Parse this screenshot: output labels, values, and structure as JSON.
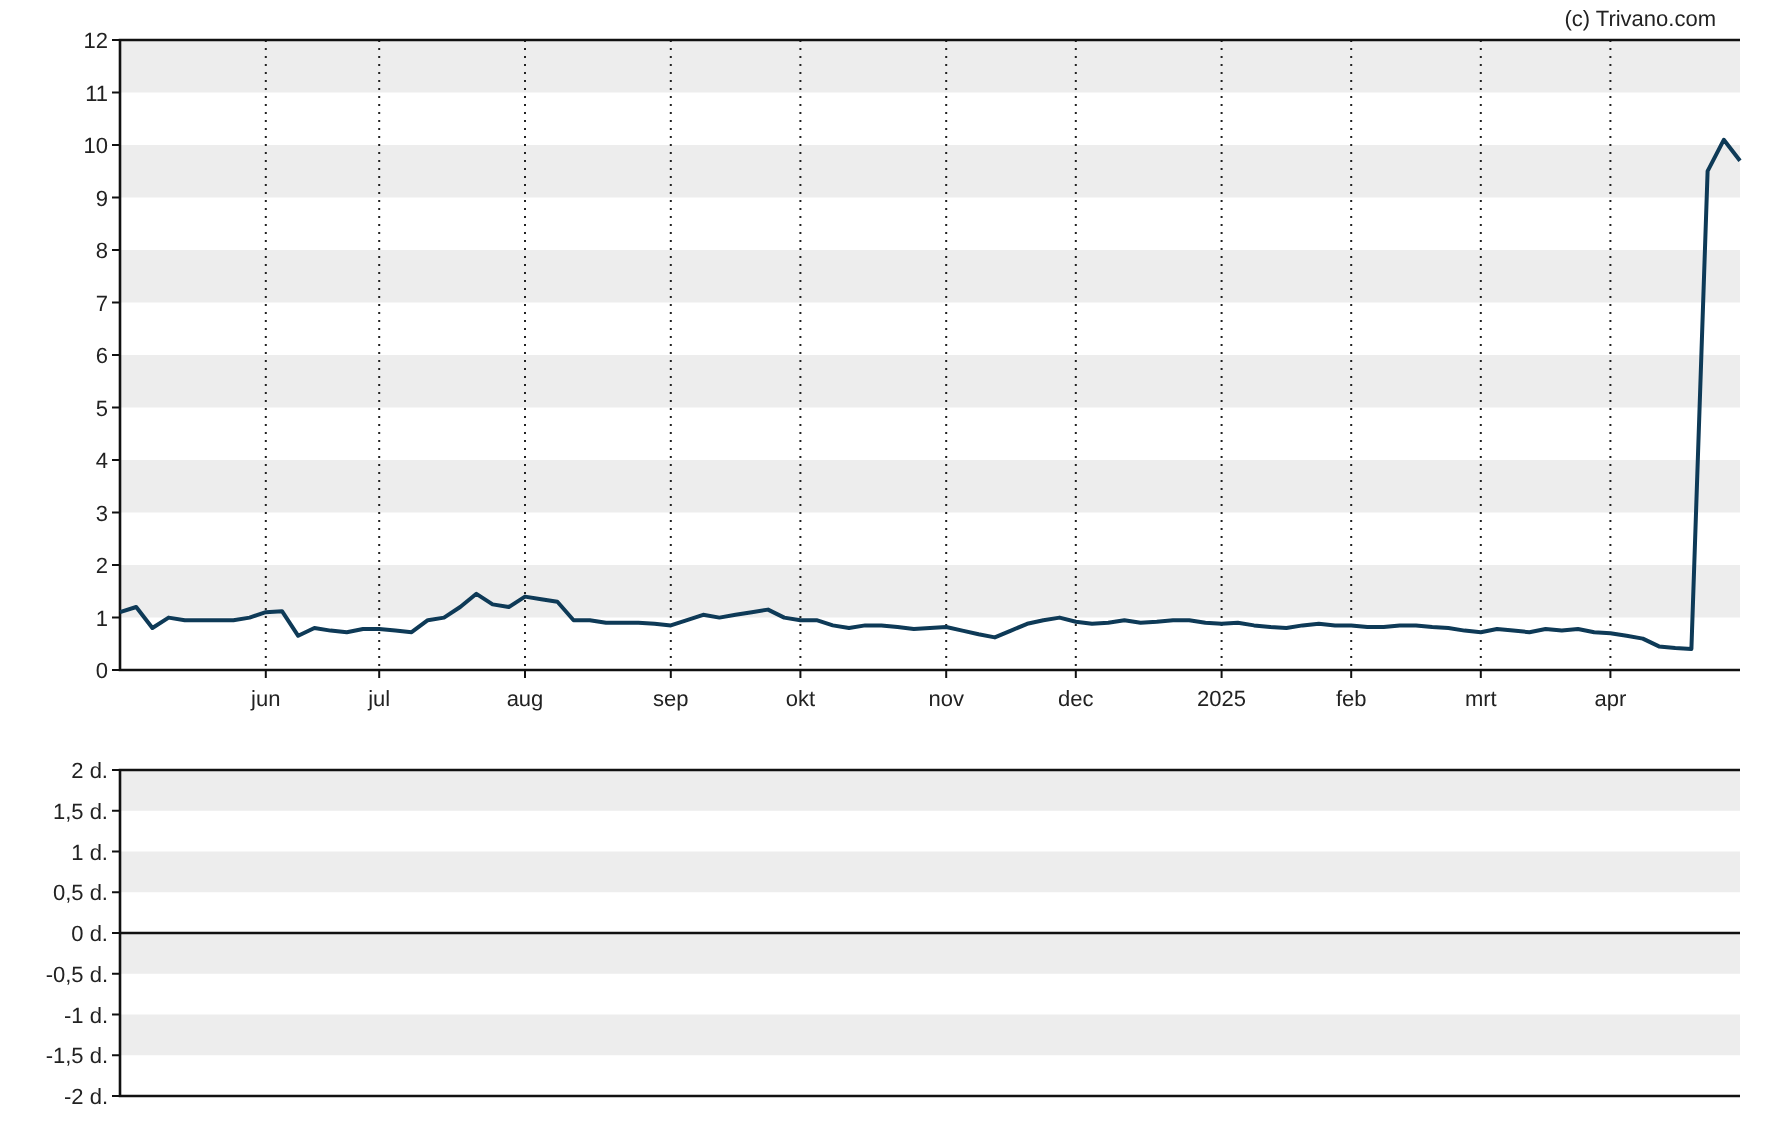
{
  "copyright": "(c) Trivano.com",
  "price_chart": {
    "chart_data": {
      "type": "line",
      "grid": true,
      "ylim": [
        0,
        12
      ],
      "yticks": [
        0,
        1,
        2,
        3,
        4,
        5,
        6,
        7,
        8,
        9,
        10,
        11,
        12
      ],
      "categories": [
        null,
        null,
        null,
        null,
        null,
        null,
        null,
        null,
        null,
        "jun",
        null,
        null,
        null,
        null,
        null,
        null,
        "jul",
        null,
        null,
        null,
        null,
        null,
        null,
        null,
        null,
        "aug",
        null,
        null,
        null,
        null,
        null,
        null,
        null,
        null,
        "sep",
        null,
        null,
        null,
        null,
        null,
        null,
        null,
        "okt",
        null,
        null,
        null,
        null,
        null,
        null,
        null,
        null,
        "nov",
        null,
        null,
        null,
        null,
        null,
        null,
        null,
        "dec",
        null,
        null,
        null,
        null,
        null,
        null,
        null,
        null,
        "2025",
        null,
        null,
        null,
        null,
        null,
        null,
        null,
        "feb",
        null,
        null,
        null,
        null,
        null,
        null,
        null,
        "mrt",
        null,
        null,
        null,
        null,
        null,
        null,
        null,
        "apr",
        null,
        null,
        null,
        null,
        null,
        null,
        null,
        null
      ],
      "series": [
        {
          "color": "#0e3a57",
          "values": [
            1.1,
            1.2,
            0.8,
            1.0,
            0.95,
            0.95,
            0.95,
            0.95,
            1.0,
            1.1,
            1.12,
            0.65,
            0.8,
            0.75,
            0.72,
            0.78,
            0.78,
            0.75,
            0.72,
            0.95,
            1.0,
            1.2,
            1.45,
            1.25,
            1.2,
            1.4,
            1.35,
            1.3,
            0.95,
            0.95,
            0.9,
            0.9,
            0.9,
            0.88,
            0.85,
            0.95,
            1.05,
            1.0,
            1.05,
            1.1,
            1.15,
            1.0,
            0.95,
            0.95,
            0.85,
            0.8,
            0.85,
            0.85,
            0.82,
            0.78,
            0.8,
            0.82,
            0.75,
            0.68,
            0.62,
            0.75,
            0.88,
            0.95,
            1.0,
            0.92,
            0.88,
            0.9,
            0.95,
            0.9,
            0.92,
            0.95,
            0.95,
            0.9,
            0.88,
            0.9,
            0.85,
            0.82,
            0.8,
            0.85,
            0.88,
            0.85,
            0.85,
            0.82,
            0.82,
            0.85,
            0.85,
            0.82,
            0.8,
            0.75,
            0.72,
            0.78,
            0.75,
            0.72,
            0.78,
            0.75,
            0.78,
            0.72,
            0.7,
            0.65,
            0.6,
            0.45,
            0.42,
            0.4,
            9.5,
            10.1,
            9.7
          ]
        }
      ]
    }
  },
  "indicator_panel": {
    "y_labels": [
      "2 d.",
      "1,5 d.",
      "1 d.",
      "0,5 d.",
      "0 d.",
      "-0,5 d.",
      "-1 d.",
      "-1,5 d.",
      "-2 d."
    ]
  }
}
